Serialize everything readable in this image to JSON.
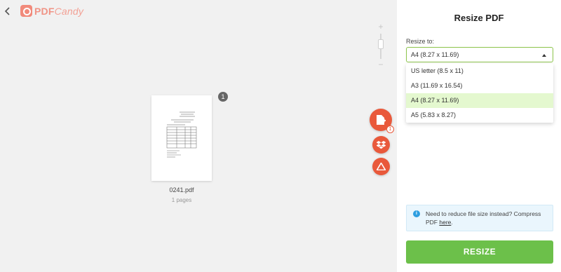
{
  "header": {
    "logo_main": "PDF",
    "logo_accent": "Candy"
  },
  "workspace": {
    "zoom_plus": "+",
    "zoom_minus": "−",
    "file": {
      "name": "0241.pdf",
      "pages": "1 pages",
      "page_badge": "1"
    },
    "add_file_count": "1"
  },
  "panel": {
    "title": "Resize PDF",
    "resize_label": "Resize to:",
    "selected_value": "A4 (8.27 x 11.69)",
    "options": [
      {
        "label": "US letter (8.5 x 11)"
      },
      {
        "label": "A3 (11.69 x 16.54)"
      },
      {
        "label": "A4 (8.27 x 11.69)"
      },
      {
        "label": "A5 (5.83 x 8.27)"
      }
    ],
    "info": {
      "icon": "i",
      "text": "Need to reduce file size instead? Compress PDF ",
      "link": "here",
      "suffix": "."
    },
    "submit_label": "RESIZE"
  },
  "colors": {
    "accent_orange": "#e9593b",
    "accent_green": "#6cc04a",
    "selected_option_bg": "#e4f8cf",
    "logo_color": "#f09385"
  }
}
